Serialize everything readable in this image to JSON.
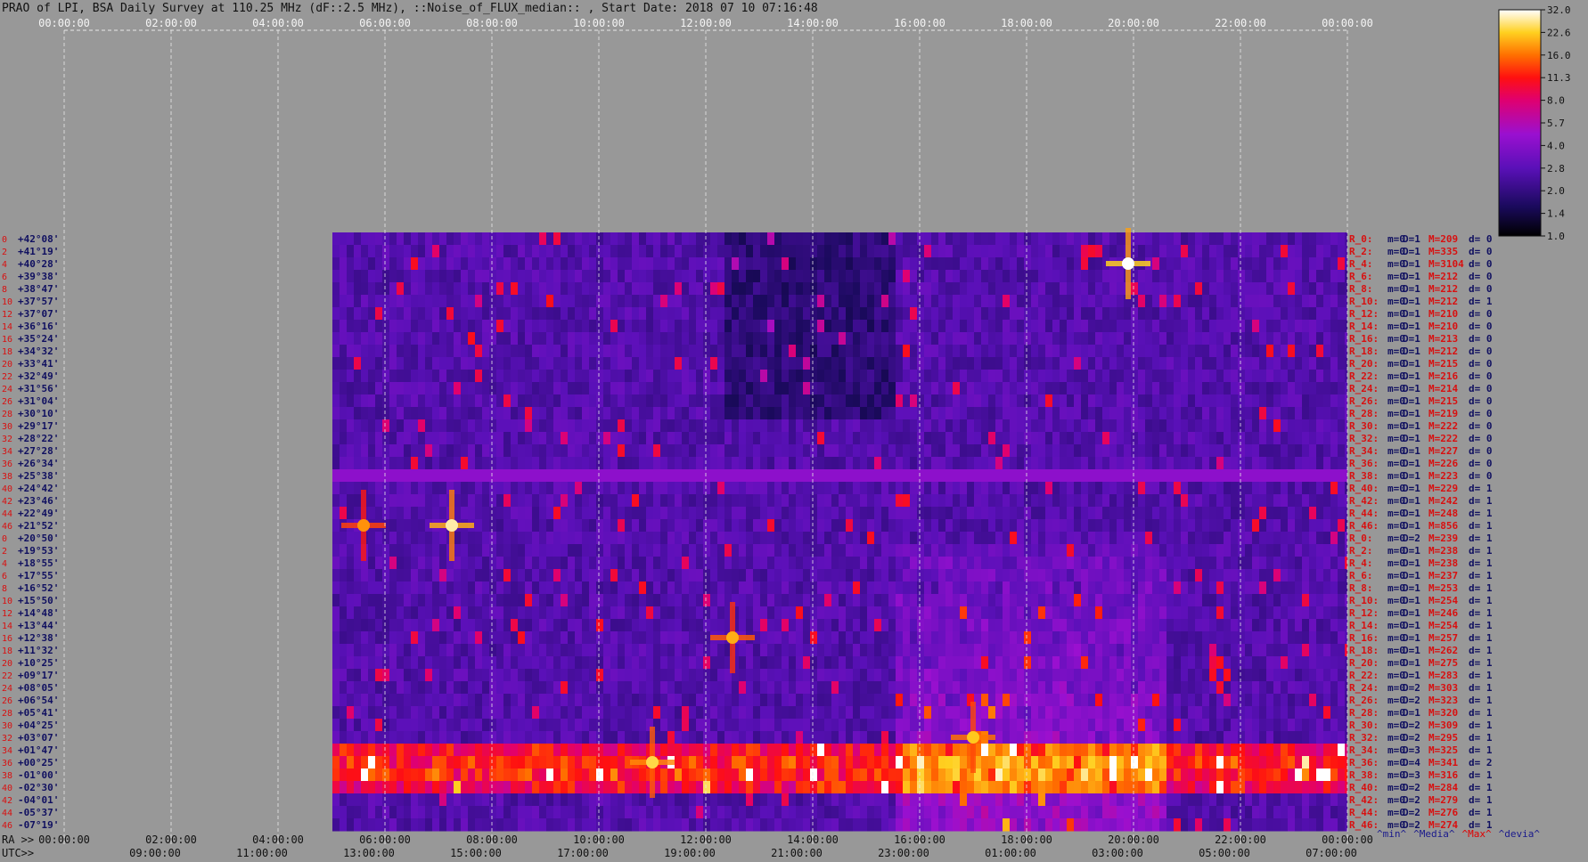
{
  "title": "PRAO of LPI, BSA Daily Survey at 110.25 MHz (dF::2.5 MHz), ::Noise_of_FLUX_median:: , Start Date: 2018 07 10 07:16:48",
  "top_axis_ticks": [
    "00:00:00",
    "02:00:00",
    "04:00:00",
    "06:00:00",
    "08:00:00",
    "10:00:00",
    "12:00:00",
    "14:00:00",
    "16:00:00",
    "18:00:00",
    "20:00:00",
    "22:00:00",
    "00:00:00"
  ],
  "bottom_ra_label": "RA >>",
  "bottom_ra_ticks": [
    "00:00:00",
    "02:00:00",
    "04:00:00",
    "06:00:00",
    "08:00:00",
    "10:00:00",
    "12:00:00",
    "14:00:00",
    "16:00:00",
    "18:00:00",
    "20:00:00",
    "22:00:00",
    "00:00:00"
  ],
  "bottom_utc_label": "UTC>>",
  "bottom_utc_ticks": [
    "09:00:00",
    "11:00:00",
    "13:00:00",
    "15:00:00",
    "17:00:00",
    "19:00:00",
    "21:00:00",
    "23:00:00",
    "01:00:00",
    "03:00:00",
    "05:00:00",
    "07:00:00"
  ],
  "colorbar": {
    "ticks": [
      "32.0",
      "22.6",
      "16.0",
      "11.3",
      "8.0",
      "5.7",
      "4.0",
      "2.8",
      "2.0",
      "1.4",
      "1.0"
    ],
    "footer": [
      {
        "text": "^min^",
        "color": "#1a1a8c"
      },
      {
        "text": "^Media^",
        "color": "#1a1a8c"
      },
      {
        "text": "^Max^",
        "color": "#e00000"
      },
      {
        "text": "^devia^",
        "color": "#1a1a8c"
      }
    ]
  },
  "colors": {
    "background": "#989898",
    "label_red": "#d81010",
    "label_navy": "#101060",
    "grid": "#e8e8e8"
  },
  "chart_data": {
    "type": "heatmap",
    "x_axis_unit": "RA (hours)",
    "x_range": [
      0,
      24
    ],
    "data_x_start": 6.2,
    "rows": [
      {
        "index": "0",
        "dec": "+42°08'",
        "stat": {
          "r": "R_0:",
          "m": "m=0",
          "D": "D=1",
          "M": "M=209",
          "d": "d= 0"
        }
      },
      {
        "index": "2",
        "dec": "+41°19'",
        "stat": {
          "r": "R_2:",
          "m": "m=0",
          "D": "D=1",
          "M": "M=335",
          "d": "d= 0"
        }
      },
      {
        "index": "4",
        "dec": "+40°28'",
        "stat": {
          "r": "R_4:",
          "m": "m=0",
          "D": "D=1",
          "M": "M=3104",
          "d": "d= 0"
        }
      },
      {
        "index": "6",
        "dec": "+39°38'",
        "stat": {
          "r": "R_6:",
          "m": "m=0",
          "D": "D=1",
          "M": "M=212",
          "d": "d= 0"
        }
      },
      {
        "index": "8",
        "dec": "+38°47'",
        "stat": {
          "r": "R_8:",
          "m": "m=0",
          "D": "D=1",
          "M": "M=212",
          "d": "d= 0"
        }
      },
      {
        "index": "10",
        "dec": "+37°57'",
        "stat": {
          "r": "R_10:",
          "m": "m=0",
          "D": "D=1",
          "M": "M=212",
          "d": "d= 1"
        }
      },
      {
        "index": "12",
        "dec": "+37°07'",
        "stat": {
          "r": "R_12:",
          "m": "m=0",
          "D": "D=1",
          "M": "M=210",
          "d": "d= 0"
        }
      },
      {
        "index": "14",
        "dec": "+36°16'",
        "stat": {
          "r": "R_14:",
          "m": "m=0",
          "D": "D=1",
          "M": "M=210",
          "d": "d= 0"
        }
      },
      {
        "index": "16",
        "dec": "+35°24'",
        "stat": {
          "r": "R_16:",
          "m": "m=0",
          "D": "D=1",
          "M": "M=213",
          "d": "d= 0"
        }
      },
      {
        "index": "18",
        "dec": "+34°32'",
        "stat": {
          "r": "R_18:",
          "m": "m=0",
          "D": "D=1",
          "M": "M=212",
          "d": "d= 0"
        }
      },
      {
        "index": "20",
        "dec": "+33°41'",
        "stat": {
          "r": "R_20:",
          "m": "m=0",
          "D": "D=1",
          "M": "M=215",
          "d": "d= 0"
        }
      },
      {
        "index": "22",
        "dec": "+32°49'",
        "stat": {
          "r": "R_22:",
          "m": "m=0",
          "D": "D=1",
          "M": "M=216",
          "d": "d= 0"
        }
      },
      {
        "index": "24",
        "dec": "+31°56'",
        "stat": {
          "r": "R_24:",
          "m": "m=0",
          "D": "D=1",
          "M": "M=214",
          "d": "d= 0"
        }
      },
      {
        "index": "26",
        "dec": "+31°04'",
        "stat": {
          "r": "R_26:",
          "m": "m=0",
          "D": "D=1",
          "M": "M=215",
          "d": "d= 0"
        }
      },
      {
        "index": "28",
        "dec": "+30°10'",
        "stat": {
          "r": "R_28:",
          "m": "m=0",
          "D": "D=1",
          "M": "M=219",
          "d": "d= 0"
        }
      },
      {
        "index": "30",
        "dec": "+29°17'",
        "stat": {
          "r": "R_30:",
          "m": "m=0",
          "D": "D=1",
          "M": "M=222",
          "d": "d= 0"
        }
      },
      {
        "index": "32",
        "dec": "+28°22'",
        "stat": {
          "r": "R_32:",
          "m": "m=0",
          "D": "D=1",
          "M": "M=222",
          "d": "d= 0"
        }
      },
      {
        "index": "34",
        "dec": "+27°28'",
        "stat": {
          "r": "R_34:",
          "m": "m=0",
          "D": "D=1",
          "M": "M=227",
          "d": "d= 0"
        }
      },
      {
        "index": "36",
        "dec": "+26°34'",
        "stat": {
          "r": "R_36:",
          "m": "m=0",
          "D": "D=1",
          "M": "M=226",
          "d": "d= 0"
        }
      },
      {
        "index": "38",
        "dec": "+25°38'",
        "stat": {
          "r": "R_38:",
          "m": "m=0",
          "D": "D=1",
          "M": "M=223",
          "d": "d= 0"
        }
      },
      {
        "index": "40",
        "dec": "+24°42'",
        "stat": {
          "r": "R_40:",
          "m": "m=0",
          "D": "D=1",
          "M": "M=229",
          "d": "d= 1"
        }
      },
      {
        "index": "42",
        "dec": "+23°46'",
        "stat": {
          "r": "R_42:",
          "m": "m=0",
          "D": "D=1",
          "M": "M=242",
          "d": "d= 1"
        }
      },
      {
        "index": "44",
        "dec": "+22°49'",
        "stat": {
          "r": "R_44:",
          "m": "m=0",
          "D": "D=1",
          "M": "M=248",
          "d": "d= 1"
        }
      },
      {
        "index": "46",
        "dec": "+21°52'",
        "stat": {
          "r": "R_46:",
          "m": "m=0",
          "D": "D=1",
          "M": "M=856",
          "d": "d= 1"
        }
      },
      {
        "index": "0",
        "dec": "+20°50'",
        "stat": {
          "r": "R_0:",
          "m": "m=0",
          "D": "D=2",
          "M": "M=239",
          "d": "d= 1"
        }
      },
      {
        "index": "2",
        "dec": "+19°53'",
        "stat": {
          "r": "R_2:",
          "m": "m=0",
          "D": "D=1",
          "M": "M=238",
          "d": "d= 1"
        }
      },
      {
        "index": "4",
        "dec": "+18°55'",
        "stat": {
          "r": "R_4:",
          "m": "m=0",
          "D": "D=1",
          "M": "M=238",
          "d": "d= 1"
        }
      },
      {
        "index": "6",
        "dec": "+17°55'",
        "stat": {
          "r": "R_6:",
          "m": "m=0",
          "D": "D=1",
          "M": "M=237",
          "d": "d= 1"
        }
      },
      {
        "index": "8",
        "dec": "+16°52'",
        "stat": {
          "r": "R_8:",
          "m": "m=0",
          "D": "D=1",
          "M": "M=253",
          "d": "d= 1"
        }
      },
      {
        "index": "10",
        "dec": "+15°50'",
        "stat": {
          "r": "R_10:",
          "m": "m=0",
          "D": "D=1",
          "M": "M=254",
          "d": "d= 1"
        }
      },
      {
        "index": "12",
        "dec": "+14°48'",
        "stat": {
          "r": "R_12:",
          "m": "m=0",
          "D": "D=1",
          "M": "M=246",
          "d": "d= 1"
        }
      },
      {
        "index": "14",
        "dec": "+13°44'",
        "stat": {
          "r": "R_14:",
          "m": "m=0",
          "D": "D=1",
          "M": "M=254",
          "d": "d= 1"
        }
      },
      {
        "index": "16",
        "dec": "+12°38'",
        "stat": {
          "r": "R_16:",
          "m": "m=0",
          "D": "D=1",
          "M": "M=257",
          "d": "d= 1"
        }
      },
      {
        "index": "18",
        "dec": "+11°32'",
        "stat": {
          "r": "R_18:",
          "m": "m=0",
          "D": "D=1",
          "M": "M=262",
          "d": "d= 1"
        }
      },
      {
        "index": "20",
        "dec": "+10°25'",
        "stat": {
          "r": "R_20:",
          "m": "m=0",
          "D": "D=1",
          "M": "M=275",
          "d": "d= 1"
        }
      },
      {
        "index": "22",
        "dec": "+09°17'",
        "stat": {
          "r": "R_22:",
          "m": "m=0",
          "D": "D=1",
          "M": "M=283",
          "d": "d= 1"
        }
      },
      {
        "index": "24",
        "dec": "+08°05'",
        "stat": {
          "r": "R_24:",
          "m": "m=0",
          "D": "D=2",
          "M": "M=303",
          "d": "d= 1"
        }
      },
      {
        "index": "26",
        "dec": "+06°54'",
        "stat": {
          "r": "R_26:",
          "m": "m=0",
          "D": "D=2",
          "M": "M=323",
          "d": "d= 1"
        }
      },
      {
        "index": "28",
        "dec": "+05°41'",
        "stat": {
          "r": "R_28:",
          "m": "m=0",
          "D": "D=1",
          "M": "M=320",
          "d": "d= 1"
        }
      },
      {
        "index": "30",
        "dec": "+04°25'",
        "stat": {
          "r": "R_30:",
          "m": "m=0",
          "D": "D=2",
          "M": "M=309",
          "d": "d= 1"
        }
      },
      {
        "index": "32",
        "dec": "+03°07'",
        "stat": {
          "r": "R_32:",
          "m": "m=0",
          "D": "D=2",
          "M": "M=295",
          "d": "d= 1"
        }
      },
      {
        "index": "34",
        "dec": "+01°47'",
        "stat": {
          "r": "R_34:",
          "m": "m=0",
          "D": "D=3",
          "M": "M=325",
          "d": "d= 1"
        }
      },
      {
        "index": "36",
        "dec": "+00°25'",
        "stat": {
          "r": "R_36:",
          "m": "m=0",
          "D": "D=4",
          "M": "M=341",
          "d": "d= 2"
        }
      },
      {
        "index": "38",
        "dec": "-01°00'",
        "stat": {
          "r": "R_38:",
          "m": "m=0",
          "D": "D=3",
          "M": "M=316",
          "d": "d= 1"
        }
      },
      {
        "index": "40",
        "dec": "-02°30'",
        "stat": {
          "r": "R_40:",
          "m": "m=0",
          "D": "D=2",
          "M": "M=284",
          "d": "d= 1"
        }
      },
      {
        "index": "42",
        "dec": "-04°01'",
        "stat": {
          "r": "R_42:",
          "m": "m=0",
          "D": "D=2",
          "M": "M=279",
          "d": "d= 1"
        }
      },
      {
        "index": "44",
        "dec": "-05°37'",
        "stat": {
          "r": "R_44:",
          "m": "m=0",
          "D": "D=2",
          "M": "M=276",
          "d": "d= 1"
        }
      },
      {
        "index": "46",
        "dec": "-07°19'",
        "stat": {
          "r": "R_46:",
          "m": "m=0",
          "D": "D=2",
          "M": "M=274",
          "d": "d= 1"
        }
      }
    ],
    "bright_sources": [
      {
        "ra": 19.9,
        "row": 2,
        "strength": 32
      },
      {
        "ra": 7.25,
        "row": 23,
        "strength": 28
      },
      {
        "ra": 5.6,
        "row": 23,
        "strength": 18
      },
      {
        "ra": 12.5,
        "row": 32,
        "strength": 20
      },
      {
        "ra": 11.0,
        "row": 42,
        "strength": 24
      },
      {
        "ra": 17.0,
        "row": 40,
        "strength": 22
      }
    ],
    "colorbar_range": [
      1.0,
      32.0
    ]
  }
}
